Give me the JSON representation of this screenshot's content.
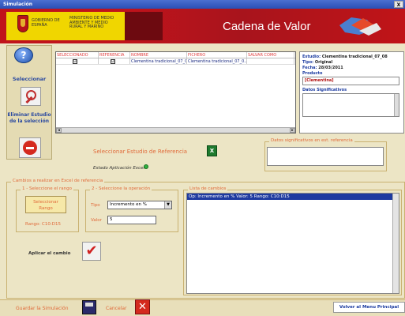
{
  "window": {
    "title": "Simulación",
    "close_label": "X"
  },
  "banner": {
    "gov_text": "GOBIERNO DE ESPAÑA",
    "ministry_text": "MINISTERIO DE MEDIO AMBIENTE Y MEDIO RURAL Y MARINO",
    "title": "Cadena de Valor"
  },
  "sidebar": {
    "help_label": "?",
    "select_label": "Seleccionar",
    "remove_label": "Eliminar Estudio de la selección"
  },
  "grid": {
    "columns": [
      "SELECCIONADO",
      "REFERENCIA",
      "NOMBRE",
      "FICHERO",
      "SALVAR COMO"
    ],
    "rows": [
      {
        "seleccionado": "☑",
        "referencia": "☑",
        "nombre": "Clementina tradicional_07_08",
        "fichero": "Clementina tradicional_07_0..."
      }
    ]
  },
  "info": {
    "estudio_label": "Estudio:",
    "estudio_value": "Clementina tradicional_07_08",
    "tipo_label": "Tipo:",
    "tipo_value": "Original",
    "fecha_label": "Fecha:",
    "fecha_value": "28/03/2011",
    "producto_label": "Producto",
    "producto_value": "[Clementina]",
    "datos_label": "Datos Significativos"
  },
  "reference": {
    "select_link": "Seleccionar Estudio de Referencia",
    "excel_icon": "X",
    "estado_label": "Estado Aplicación Excel",
    "datos_ref_legend": "Datos significativos en est. referencia"
  },
  "cambios": {
    "legend": "Cambios a realizar en Excel de referencia",
    "step1_legend": "1 - Seleccione el rango",
    "rango_button": "Seleccionar Rango",
    "rango_value": "Rango: C10:D15",
    "step2_legend": "2 - Seleccione la operación",
    "tipo_label": "Tipo",
    "tipo_value": "Incremento en %",
    "valor_label": "Valor",
    "valor_value": "5",
    "lista_legend": "Lista de cambios",
    "lista_items": [
      "Op: Incremento en % Valor: 5 Rango: C10:D15"
    ],
    "aplicar_label": "Aplicar el cambio",
    "aplicar_icon": "✔"
  },
  "bottom": {
    "guardar_label": "Guardar la Simulación",
    "cancel_label": "Cancelar",
    "cancel_icon": "✕",
    "volver_label": "Volver al Menu Principal"
  }
}
